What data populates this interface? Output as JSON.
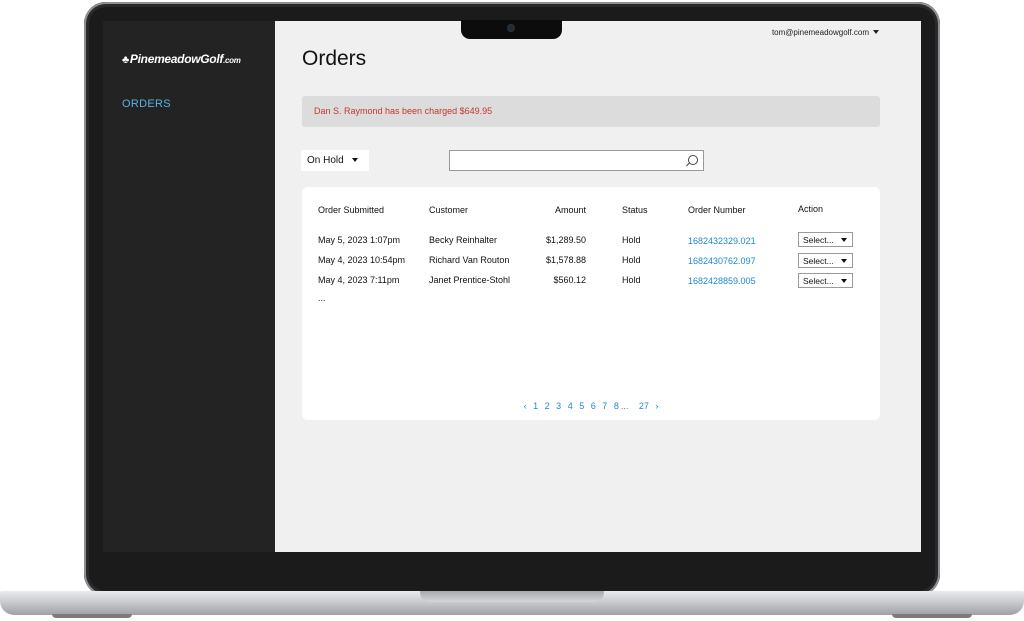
{
  "user": {
    "email": "tom@pinemeadowgolf.com"
  },
  "sidebar": {
    "logo": {
      "main": "PinemeadowGolf",
      "suffix": ".com"
    },
    "items": [
      {
        "label": "ORDERS"
      }
    ]
  },
  "main": {
    "title": "Orders",
    "alert": "Dan S. Raymond has been charged $649.95",
    "filter": {
      "selected": "On Hold"
    },
    "search": {
      "value": "",
      "placeholder": ""
    },
    "table": {
      "headers": [
        "Order Submitted",
        "Customer",
        "Amount",
        "Status",
        "Order Number",
        "Action"
      ],
      "rows": [
        {
          "submitted": "May 5, 2023 1:07pm",
          "customer": "Becky Reinhalter",
          "amount": "$1,289.50",
          "status": "Hold",
          "order_number": "1682432329.021",
          "action": "Select..."
        },
        {
          "submitted": "May 4, 2023 10:54pm",
          "customer": "Richard Van Routon",
          "amount": "$1,578.88",
          "status": "Hold",
          "order_number": "1682430762.097",
          "action": "Select..."
        },
        {
          "submitted": "May 4, 2023 7:11pm",
          "customer": "Janet Prentice-Stohl",
          "amount": "$560.12",
          "status": "Hold",
          "order_number": "1682428859.005",
          "action": "Select..."
        }
      ],
      "more": "..."
    },
    "pagination": {
      "prev": "‹",
      "pages": [
        "1",
        "2",
        "3",
        "4",
        "5",
        "6",
        "7",
        "8"
      ],
      "gap": "...",
      "last": "27",
      "next": "›"
    }
  },
  "colors": {
    "accent_link": "#1e88d0",
    "sidebar_bg": "#232323",
    "alert_text": "#c0392b",
    "nav_active": "#5ab0ea"
  },
  "icons": {
    "search": "search-icon",
    "dropdown": "chevron-down-icon",
    "logo_mark": "pine-tree-icon"
  }
}
